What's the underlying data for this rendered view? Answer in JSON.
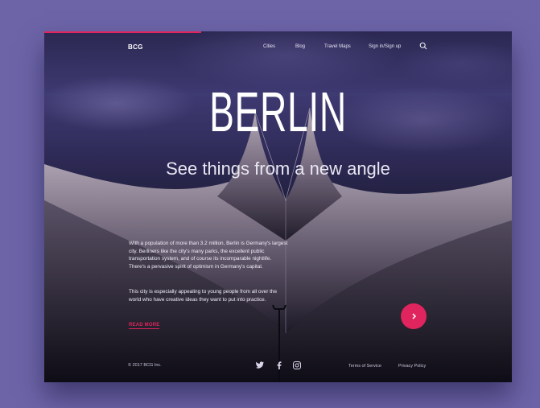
{
  "header": {
    "brand": "BCG",
    "nav": [
      "Cities",
      "Blog",
      "Travel Maps",
      "Sign in/Sign up"
    ],
    "search_icon": "search-icon"
  },
  "hero": {
    "title": "BERLIN",
    "subtitle": "See things from a new angle"
  },
  "content": {
    "paragraph1": "With a population of more than 3.2 million, Berlin is Germany's largest city. Berliners like the city's many parks, the excellent public transportation system, and of course its incomparable nightlife. There's a pervasive spirit of optimism in Germany's capital.",
    "paragraph2": "This city is especially appealing to young people from all over the world who have creative ideas they want to put into practice.",
    "read_more": "READ MORE",
    "next_icon": "chevron-right-icon"
  },
  "footer": {
    "copyright": "© 2017 BCG Inc.",
    "social_icons": [
      "twitter-icon",
      "facebook-icon",
      "instagram-icon"
    ],
    "links": [
      "Terms of Service",
      "Privacy Policy"
    ]
  },
  "colors": {
    "background": "#6c64a7",
    "accent": "#e0245e",
    "text": "#ffffff"
  }
}
